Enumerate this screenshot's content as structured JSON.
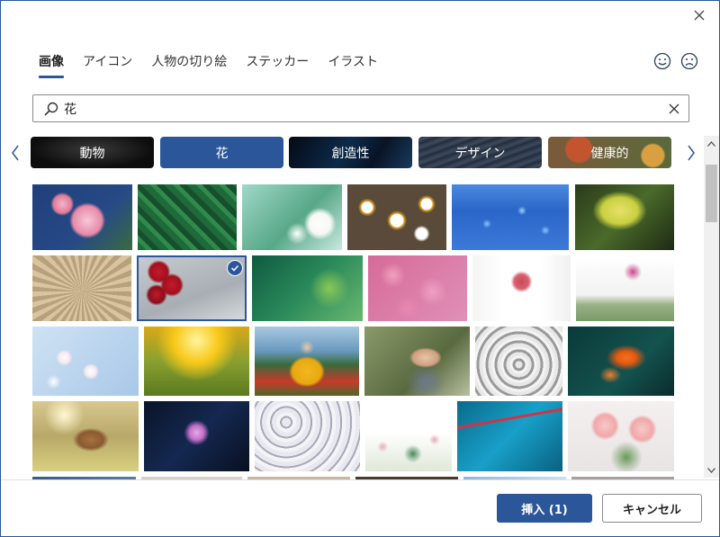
{
  "dialog": {
    "close_icon": "close-icon",
    "tabs": [
      {
        "label": "画像",
        "active": true
      },
      {
        "label": "アイコン",
        "active": false
      },
      {
        "label": "人物の切り絵",
        "active": false
      },
      {
        "label": "ステッカー",
        "active": false
      },
      {
        "label": "イラスト",
        "active": false
      }
    ],
    "feedback": {
      "happy_icon": "smiley-face-icon",
      "sad_icon": "frowning-face-icon"
    },
    "search": {
      "value": "花",
      "icon": "search-icon",
      "clear_icon": "clear-icon"
    },
    "categories": [
      {
        "label": "動物",
        "selected": false
      },
      {
        "label": "花",
        "selected": true
      },
      {
        "label": "創造性",
        "selected": false
      },
      {
        "label": "デザイン",
        "selected": false
      },
      {
        "label": "健康的",
        "selected": false
      }
    ],
    "images": [
      {
        "subject": "plumeria flowers",
        "selected": false
      },
      {
        "subject": "green leaves",
        "selected": false
      },
      {
        "subject": "white blossoms",
        "selected": false
      },
      {
        "subject": "daisies",
        "selected": false
      },
      {
        "subject": "blue nemophila field",
        "selected": false
      },
      {
        "subject": "ginkgo leaves",
        "selected": false
      },
      {
        "subject": "dandelion seed head",
        "selected": false
      },
      {
        "subject": "red roses on wood",
        "selected": true
      },
      {
        "subject": "green plant bokeh",
        "selected": false
      },
      {
        "subject": "pink hydrangea",
        "selected": false
      },
      {
        "subject": "bride bouquet",
        "selected": false
      },
      {
        "subject": "hands with flowers",
        "selected": false
      },
      {
        "subject": "cherry blossoms",
        "selected": false
      },
      {
        "subject": "yellow meadow",
        "selected": false
      },
      {
        "subject": "person in yellow hoodie",
        "selected": false
      },
      {
        "subject": "woman blowing dandelion",
        "selected": false
      },
      {
        "subject": "white chrysanthemum",
        "selected": false
      },
      {
        "subject": "bird of paradise",
        "selected": false
      },
      {
        "subject": "dog in flower field",
        "selected": false
      },
      {
        "subject": "purple flower bokeh",
        "selected": false
      },
      {
        "subject": "floral pattern",
        "selected": false
      },
      {
        "subject": "wildflowers on white",
        "selected": false
      },
      {
        "subject": "water drops on wire",
        "selected": false
      },
      {
        "subject": "pink peonies",
        "selected": false
      }
    ],
    "scroll_up_icon": "chevron-up-icon",
    "scroll_down_icon": "chevron-down-icon",
    "insert_label": "挿入 (1)",
    "cancel_label": "キャンセル"
  }
}
